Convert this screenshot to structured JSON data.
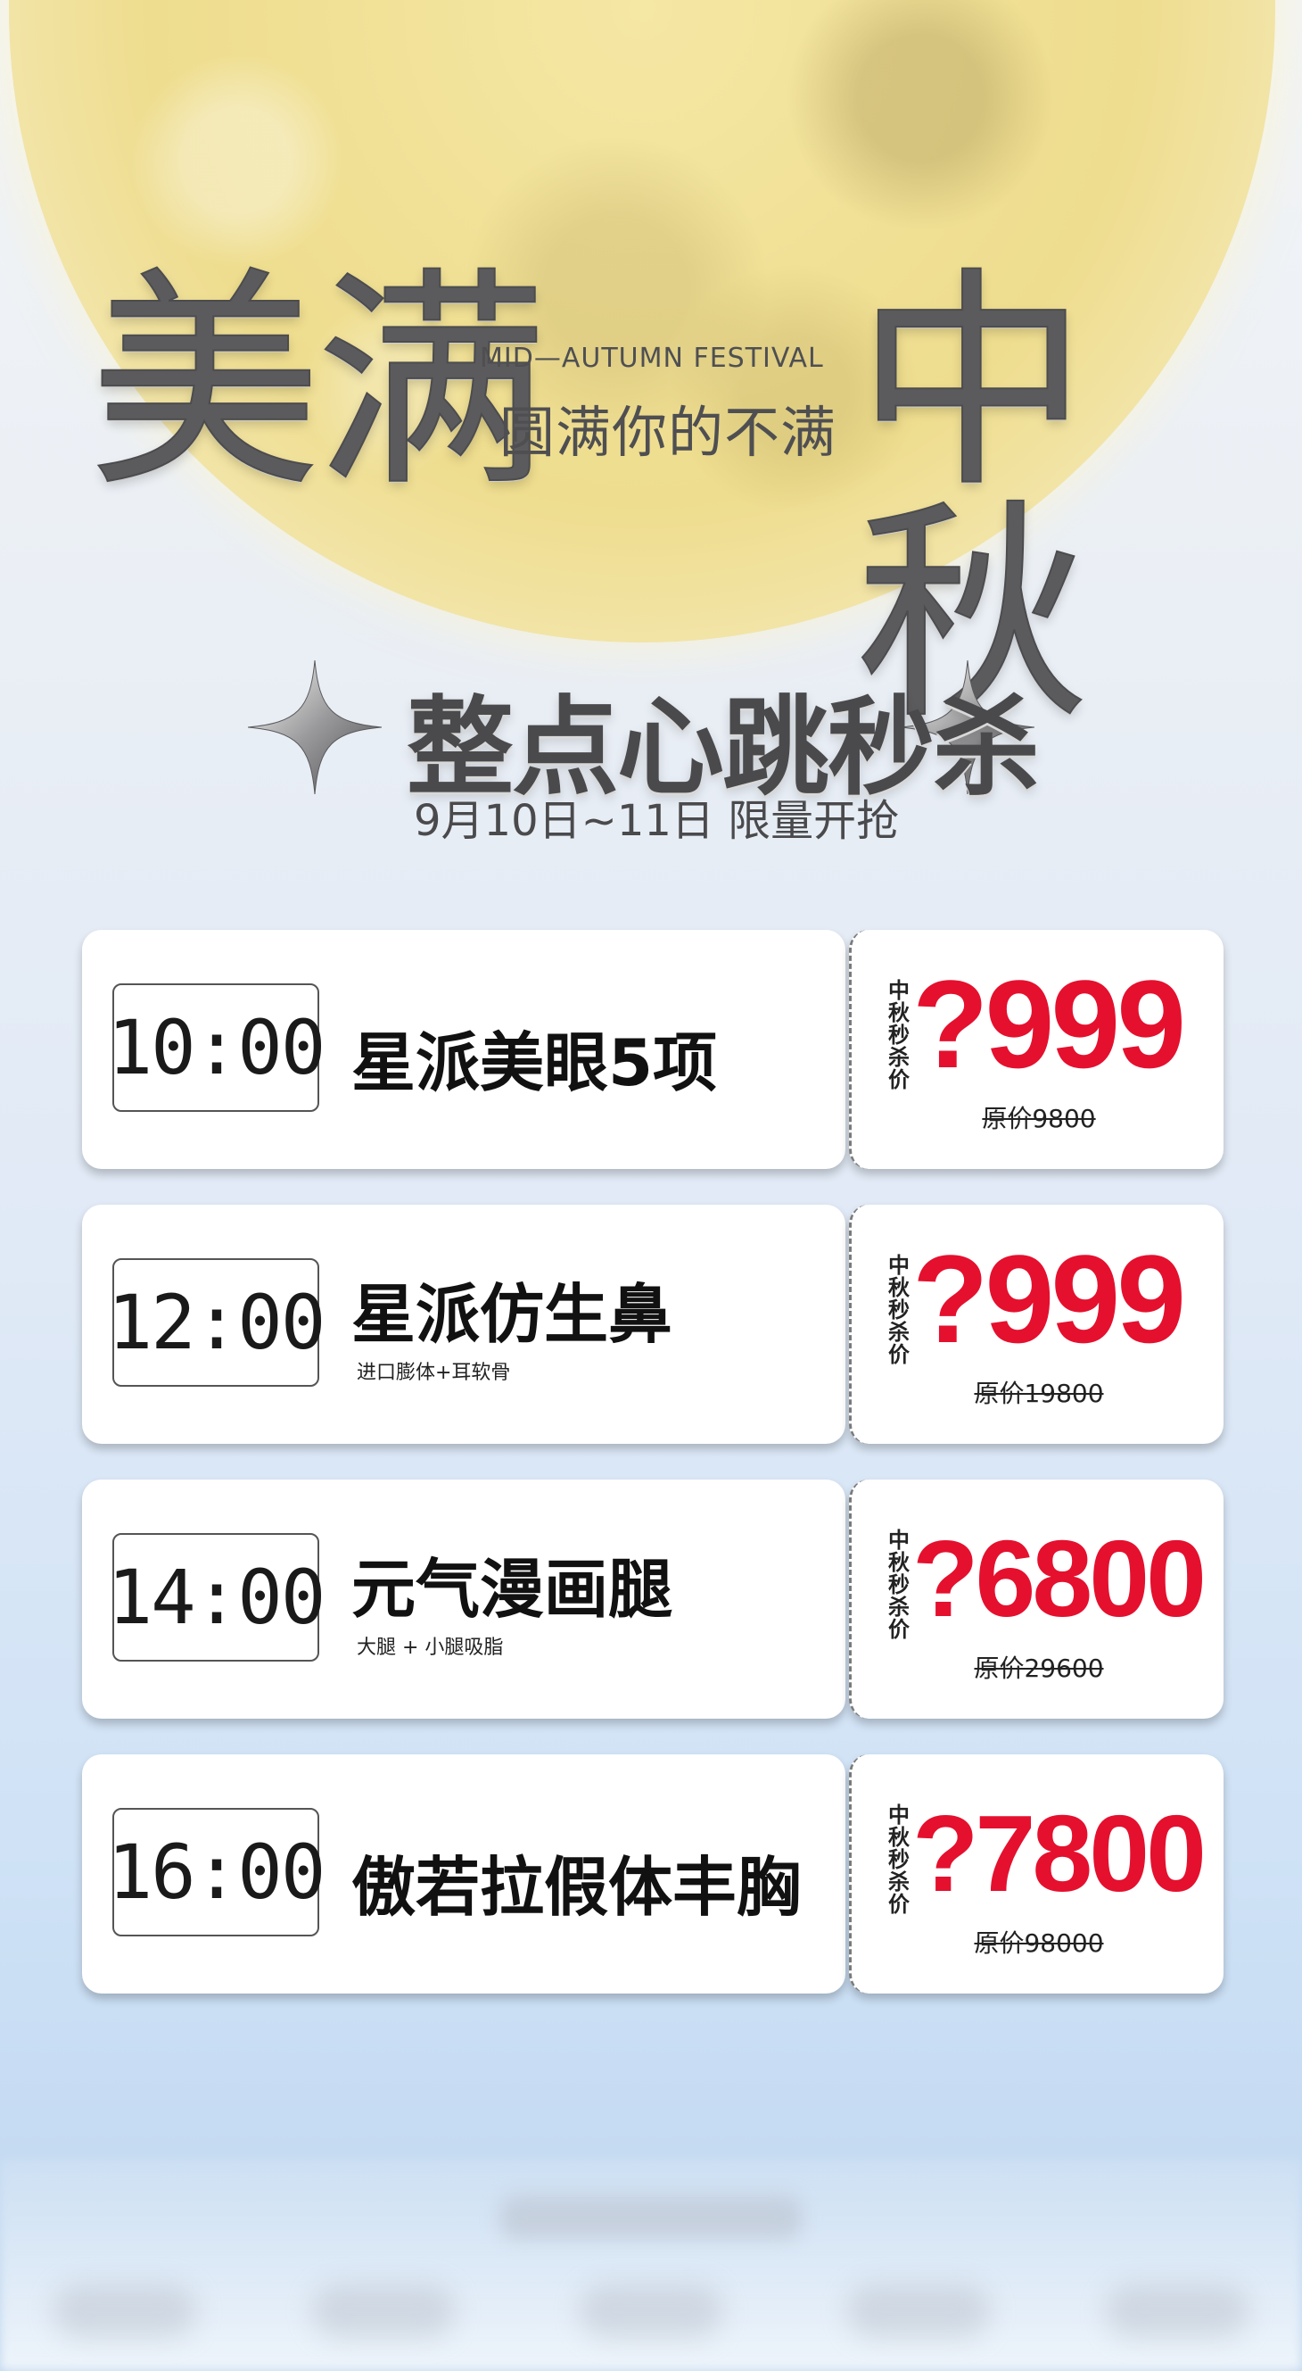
{
  "header": {
    "title_left": "美满",
    "title_right": "中秋",
    "festival_en": "MID—AUTUMN FESTIVAL",
    "festival_cn": "圆满你的不满"
  },
  "flash_sale": {
    "title": "整点心跳秒杀",
    "date": "9月10日~11日 限量开抢"
  },
  "promo_label": "中秋秒杀价",
  "items": [
    {
      "time": "10:00",
      "name": "星派美眼5项",
      "subtitle": "",
      "price": "?999",
      "original_price": "原价9800"
    },
    {
      "time": "12:00",
      "name": "星派仿生鼻",
      "subtitle": "进口膨体+耳软骨",
      "price": "?999",
      "original_price": "原价19800"
    },
    {
      "time": "14:00",
      "name": "元气漫画腿",
      "subtitle": "大腿 + 小腿吸脂",
      "price": "?6800",
      "original_price": "原价29600"
    },
    {
      "time": "16:00",
      "name": "傲若拉假体丰胸",
      "subtitle": "",
      "price": "?7800",
      "original_price": "原价98000"
    }
  ],
  "colors": {
    "price_red": "#e5102e",
    "title_gray": "#5b5b5d",
    "moon_yellow": "#eedd8e"
  }
}
